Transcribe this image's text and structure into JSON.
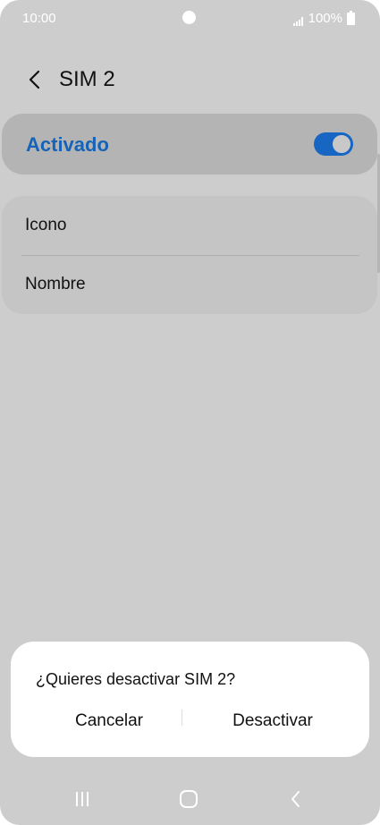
{
  "status_bar": {
    "time": "10:00",
    "battery": "100%"
  },
  "header": {
    "title": "SIM 2"
  },
  "activated": {
    "label": "Activado",
    "enabled": true
  },
  "settings": {
    "items": [
      {
        "label": "Icono"
      },
      {
        "label": "Nombre"
      }
    ]
  },
  "dialog": {
    "message": "¿Quieres desactivar SIM 2?",
    "cancel_label": "Cancelar",
    "confirm_label": "Desactivar"
  },
  "icons": {
    "back": "chevron-left-icon",
    "signal": "signal-icon",
    "battery": "battery-icon",
    "nav_recents": "recents-icon",
    "nav_home": "home-icon",
    "nav_back": "back-icon"
  },
  "colors": {
    "accent": "#1766c4",
    "background": "#cdcdcd",
    "dialog": "#ffffff"
  }
}
